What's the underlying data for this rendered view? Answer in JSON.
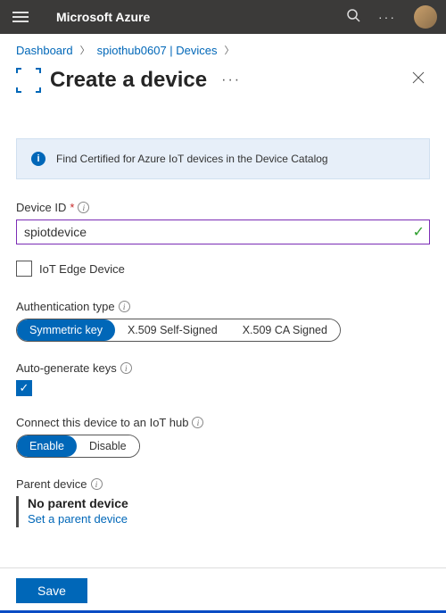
{
  "topbar": {
    "brand": "Microsoft Azure"
  },
  "breadcrumb": {
    "items": [
      "Dashboard",
      "spiothub0607 | Devices"
    ]
  },
  "header": {
    "title": "Create a device"
  },
  "banner": {
    "text": "Find Certified for Azure IoT devices in the Device Catalog"
  },
  "form": {
    "device_id_label": "Device ID",
    "device_id_value": "spiotdevice",
    "iot_edge_label": "IoT Edge Device",
    "iot_edge_checked": false,
    "auth_label": "Authentication type",
    "auth_options": [
      "Symmetric key",
      "X.509 Self-Signed",
      "X.509 CA Signed"
    ],
    "auth_selected": "Symmetric key",
    "autogen_label": "Auto-generate keys",
    "autogen_checked": true,
    "connect_label": "Connect this device to an IoT hub",
    "connect_options": [
      "Enable",
      "Disable"
    ],
    "connect_selected": "Enable",
    "parent_label": "Parent device",
    "parent_value": "No parent device",
    "parent_link": "Set a parent device"
  },
  "footer": {
    "save_label": "Save"
  }
}
